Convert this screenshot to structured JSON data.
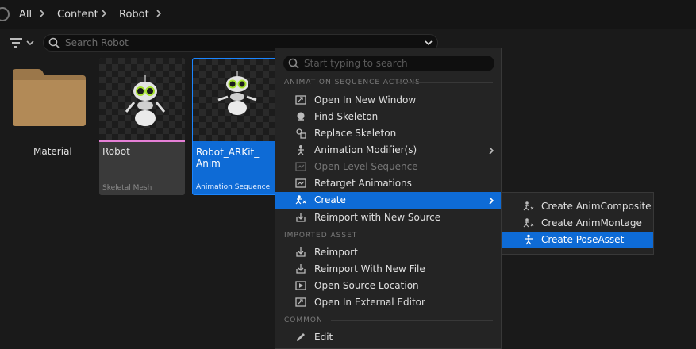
{
  "breadcrumb": [
    "All",
    "Content",
    "Robot"
  ],
  "search": {
    "placeholder": "Search Robot"
  },
  "assets": [
    {
      "name": "Material",
      "type": ""
    },
    {
      "name": "Robot",
      "type": "Skeletal Mesh"
    },
    {
      "name": "Robot_ARKit_\nAnim",
      "type": "Animation Sequence"
    }
  ],
  "context_menu": {
    "search_placeholder": "Start typing to search",
    "sections": [
      {
        "title": "ANIMATION SEQUENCE ACTIONS",
        "items": [
          {
            "label": "Open In New Window",
            "icon": "window-icon"
          },
          {
            "label": "Find Skeleton",
            "icon": "search-icon"
          },
          {
            "label": "Replace Skeleton",
            "icon": "skeleton-icon"
          },
          {
            "label": "Animation Modifier(s)",
            "icon": "modifier-icon",
            "submenu": true
          },
          {
            "label": "Open Level Sequence",
            "icon": "sequence-icon",
            "disabled": true
          },
          {
            "label": "Retarget Animations",
            "icon": "retarget-icon"
          },
          {
            "label": "Create",
            "icon": "create-icon",
            "submenu": true,
            "highlighted": true
          },
          {
            "label": "Reimport with New Source",
            "icon": "reimport-icon"
          }
        ]
      },
      {
        "title": "IMPORTED ASSET",
        "items": [
          {
            "label": "Reimport",
            "icon": "reimport-icon"
          },
          {
            "label": "Reimport With New File",
            "icon": "reimport-icon"
          },
          {
            "label": "Open Source Location",
            "icon": "folder-icon"
          },
          {
            "label": "Open In External Editor",
            "icon": "external-icon"
          }
        ]
      },
      {
        "title": "COMMON",
        "items": [
          {
            "label": "Edit",
            "icon": "edit-icon"
          }
        ]
      }
    ]
  },
  "submenu": {
    "items": [
      {
        "label": "Create AnimComposite",
        "icon": "anim-icon"
      },
      {
        "label": "Create AnimMontage",
        "icon": "anim-icon"
      },
      {
        "label": "Create PoseAsset",
        "icon": "pose-icon",
        "highlighted": true
      }
    ]
  },
  "colors": {
    "accent": "#0e6bd6",
    "skeletal_mesh": "#e57fd6",
    "anim_sequence": "#0e6bd6"
  }
}
